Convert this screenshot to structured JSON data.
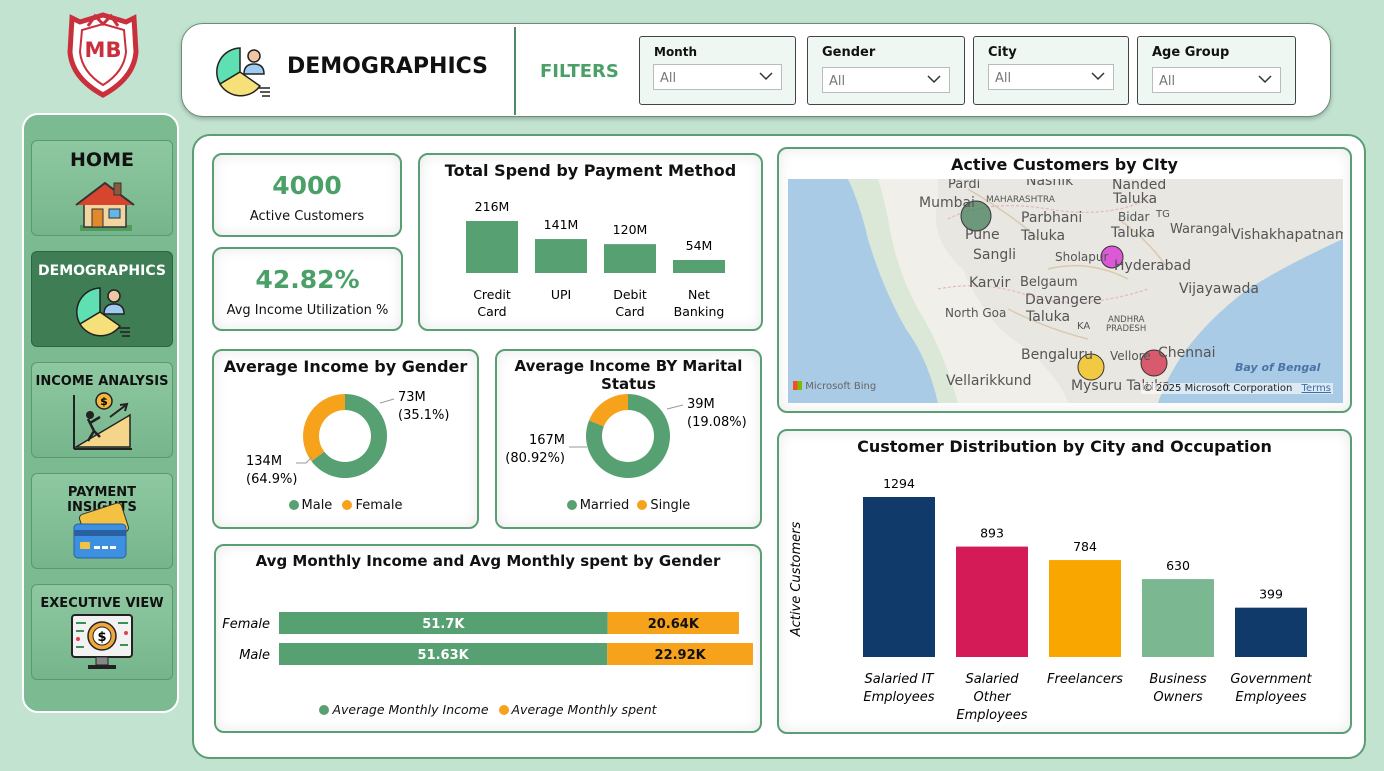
{
  "brand": {
    "logo_text": "MB"
  },
  "sidebar": {
    "items": [
      {
        "label": "HOME",
        "icon": "house-icon"
      },
      {
        "label": "DEMOGRAPHICS",
        "icon": "pie-person-icon"
      },
      {
        "label": "INCOME ANALYSIS",
        "icon": "growth-climb-icon"
      },
      {
        "label": "PAYMENT INSIGHTS",
        "icon": "credit-card-icon"
      },
      {
        "label": "EXECUTIVE VIEW",
        "icon": "monitor-dollar-icon"
      }
    ]
  },
  "header": {
    "title": "DEMOGRAPHICS",
    "filters_label": "FILTERS",
    "filters": [
      {
        "label": "Month",
        "value": "All"
      },
      {
        "label": "Gender",
        "value": "All"
      },
      {
        "label": "City",
        "value": "All"
      },
      {
        "label": "Age Group",
        "value": "All"
      }
    ]
  },
  "kpis": {
    "active_customers": {
      "value": "4000",
      "label": "Active Customers"
    },
    "avg_income_utilization": {
      "value": "42.82%",
      "label": "Avg Income Utilization %"
    }
  },
  "map": {
    "title": "Active Customers by CIty",
    "places": [
      "Pardi",
      "Nashik",
      "Nanded",
      "Mumbai",
      "MAHARASHTRA",
      "Taluka",
      "Parbhani",
      "Bidar",
      "TG",
      "Taluka",
      "Warangal",
      "Vishakhapatnam",
      "Pune",
      "Taluka",
      "Sangli",
      "Sholapur",
      "Hyderabad",
      "Karvir",
      "Belgaum",
      "Vijayawada",
      "Davangere",
      "Taluka",
      "North Goa",
      "KA",
      "ANDHRA",
      "PRADESH",
      "Bengaluru",
      "Vellore",
      "Chennai",
      "Vellarikkund",
      "Mysuru Taluka",
      "Bay of Bengal"
    ],
    "bing_label": "Microsoft Bing",
    "copyright": "© 2025 Microsoft Corporation",
    "terms": "Terms",
    "colors": {
      "mumbai": "#3d7a55",
      "hyderabad": "#d82fd4",
      "bengaluru": "#f2c21b",
      "chennai": "#d4324b"
    }
  },
  "chart_data": [
    {
      "id": "payment",
      "type": "bar",
      "title": "Total Spend by Payment Method",
      "categories": [
        "Credit Card",
        "UPI",
        "Debit Card",
        "Net Banking"
      ],
      "category_lines": [
        [
          "Credit",
          "Card"
        ],
        [
          "UPI"
        ],
        [
          "Debit",
          "Card"
        ],
        [
          "Net",
          "Banking"
        ]
      ],
      "values": [
        216,
        141,
        120,
        54
      ],
      "labels": [
        "216M",
        "141M",
        "120M",
        "54M"
      ],
      "unit": "M",
      "color": "#57a071"
    },
    {
      "id": "gender_donut",
      "type": "pie",
      "title": "Average Income by Gender",
      "categories": [
        "Male",
        "Female"
      ],
      "values": [
        134,
        73
      ],
      "value_labels": [
        "134M",
        "73M"
      ],
      "pct_labels": [
        "(64.9%)",
        "(35.1%)"
      ],
      "colors": [
        "#57a071",
        "#f7a21b"
      ]
    },
    {
      "id": "marital_donut",
      "type": "pie",
      "title": "Average Income BY Marital Status",
      "categories": [
        "Married",
        "Single"
      ],
      "values": [
        167,
        39
      ],
      "value_labels": [
        "167M",
        "39M"
      ],
      "pct_labels": [
        "(80.92%)",
        "(19.08%)"
      ],
      "colors": [
        "#57a071",
        "#f7a21b"
      ]
    },
    {
      "id": "monthly_gender",
      "type": "bar",
      "orientation": "horizontal-stacked",
      "title": "Avg Monthly Income and Avg Monthly spent by Gender",
      "categories": [
        "Female",
        "Male"
      ],
      "series": [
        {
          "name": "Average Monthly Income",
          "values": [
            51.7,
            51.63
          ],
          "labels": [
            "51.7K",
            "51.63K"
          ],
          "color": "#57a071"
        },
        {
          "name": "Average Monthly spent",
          "values": [
            20.64,
            22.92
          ],
          "labels": [
            "20.64K",
            "22.92K"
          ],
          "color": "#f7a21b"
        }
      ]
    },
    {
      "id": "occupation",
      "type": "bar",
      "title": "Customer Distribution by City and Occupation",
      "ylabel": "Active Customers",
      "categories": [
        "Salaried IT Employees",
        "Salaried Other Employees",
        "Freelancers",
        "Business Owners",
        "Government Employees"
      ],
      "category_lines": [
        [
          "Salaried IT",
          "Employees"
        ],
        [
          "Salaried",
          "Other",
          "Employees"
        ],
        [
          "Freelancers"
        ],
        [
          "Business",
          "Owners"
        ],
        [
          "Government",
          "Employees"
        ]
      ],
      "values": [
        1294,
        893,
        784,
        630,
        399
      ],
      "colors": [
        "#103a69",
        "#d41b57",
        "#f9a601",
        "#7bb791",
        "#103a69"
      ]
    }
  ]
}
